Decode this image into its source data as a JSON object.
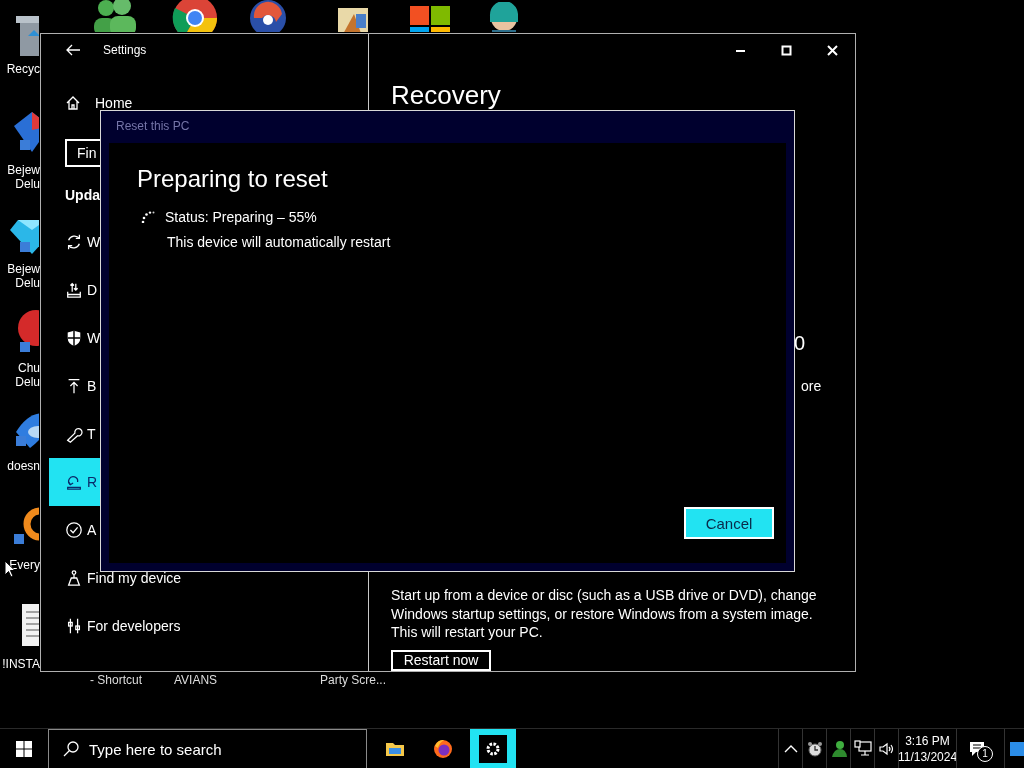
{
  "desktop": {
    "icons": [
      {
        "lines": [
          "Recyc"
        ]
      },
      {
        "lines": [
          "Bejew",
          "Delu"
        ]
      },
      {
        "lines": [
          "Bejew",
          "Delu"
        ]
      },
      {
        "lines": [
          "Chu",
          "Delu"
        ]
      },
      {
        "lines": [
          "doesn"
        ]
      },
      {
        "lines": [
          "Every"
        ]
      },
      {
        "lines": [
          "!INSTA"
        ]
      }
    ],
    "bottom_labels": [
      "- Shortcut",
      "AVIANS",
      "Party Scre..."
    ]
  },
  "settings": {
    "title": "Settings",
    "home": "Home",
    "search": {
      "placeholder": "Fin"
    },
    "section": "Upda",
    "items": [
      {
        "label": "W",
        "selected": false
      },
      {
        "label": "D",
        "selected": false
      },
      {
        "label": "W",
        "selected": false
      },
      {
        "label": "B",
        "selected": false
      },
      {
        "label": "T",
        "selected": false
      },
      {
        "label": "R",
        "selected": true
      },
      {
        "label": "A",
        "selected": false
      },
      {
        "label": "Find my device",
        "selected": false
      },
      {
        "label": "For developers",
        "selected": false
      }
    ],
    "page": {
      "heading": "Recovery",
      "fragments": [
        "0",
        "ore"
      ],
      "description": "Start up from a device or disc (such as a USB drive or DVD), change Windows startup settings, or restore Windows from a system image. This will restart your PC.",
      "button": "Restart now"
    }
  },
  "dialog": {
    "title": "Reset this PC",
    "heading": "Preparing to reset",
    "status": "Status: Preparing – 55%",
    "note": "This device will automatically restart",
    "cancel": "Cancel"
  },
  "taskbar": {
    "search_placeholder": "Type here to search",
    "apps": [
      {
        "selected": false
      },
      {
        "selected": false
      },
      {
        "selected": true
      }
    ],
    "time": "3:16 PM",
    "date": "11/13/2024",
    "notifications": "1"
  }
}
